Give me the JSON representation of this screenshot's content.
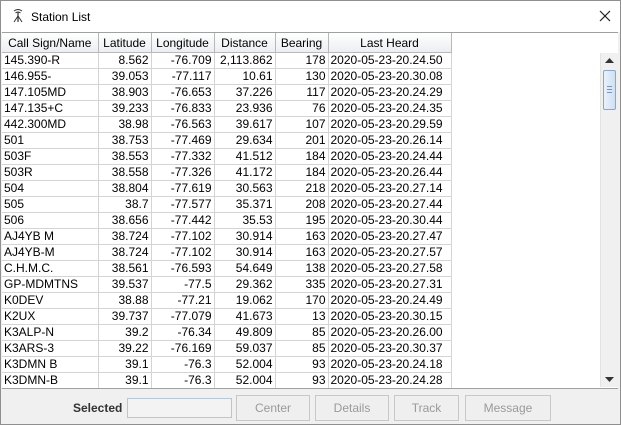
{
  "window": {
    "title": "Station List"
  },
  "icons": {
    "app": "antenna-icon",
    "close": "close-icon"
  },
  "table": {
    "columns": [
      "Call Sign/Name",
      "Latitude",
      "Longitude",
      "Distance",
      "Bearing",
      "Last Heard"
    ],
    "rows": [
      [
        "145.390-R",
        "8.562",
        "-76.709",
        "2,113.862",
        "178",
        "2020-05-23-20.24.50"
      ],
      [
        "146.955-",
        "39.053",
        "-77.117",
        "10.61",
        "130",
        "2020-05-23-20.30.08"
      ],
      [
        "147.105MD",
        "38.903",
        "-76.653",
        "37.226",
        "117",
        "2020-05-23-20.24.29"
      ],
      [
        "147.135+C",
        "39.233",
        "-76.833",
        "23.936",
        "76",
        "2020-05-23-20.24.35"
      ],
      [
        "442.300MD",
        "38.98",
        "-76.563",
        "39.617",
        "107",
        "2020-05-23-20.29.59"
      ],
      [
        "501",
        "38.753",
        "-77.469",
        "29.634",
        "201",
        "2020-05-23-20.26.14"
      ],
      [
        "503F",
        "38.553",
        "-77.332",
        "41.512",
        "184",
        "2020-05-23-20.24.44"
      ],
      [
        "503R",
        "38.558",
        "-77.326",
        "41.172",
        "184",
        "2020-05-23-20.26.44"
      ],
      [
        "504",
        "38.804",
        "-77.619",
        "30.563",
        "218",
        "2020-05-23-20.27.14"
      ],
      [
        "505",
        "38.7",
        "-77.577",
        "35.371",
        "208",
        "2020-05-23-20.27.44"
      ],
      [
        "506",
        "38.656",
        "-77.442",
        "35.53",
        "195",
        "2020-05-23-20.30.44"
      ],
      [
        "AJ4YB  M",
        "38.724",
        "-77.102",
        "30.914",
        "163",
        "2020-05-23-20.27.47"
      ],
      [
        "AJ4YB-M",
        "38.724",
        "-77.102",
        "30.914",
        "163",
        "2020-05-23-20.27.57"
      ],
      [
        "C.H.M.C.",
        "38.561",
        "-76.593",
        "54.649",
        "138",
        "2020-05-23-20.27.58"
      ],
      [
        "GP-MDMTNS",
        "39.537",
        "-77.5",
        "29.362",
        "335",
        "2020-05-23-20.27.31"
      ],
      [
        "K0DEV",
        "38.88",
        "-77.21",
        "19.062",
        "170",
        "2020-05-23-20.24.49"
      ],
      [
        "K2UX",
        "39.737",
        "-77.079",
        "41.673",
        "13",
        "2020-05-23-20.30.15"
      ],
      [
        "K3ALP-N",
        "39.2",
        "-76.34",
        "49.809",
        "85",
        "2020-05-23-20.26.00"
      ],
      [
        "K3ARS-3",
        "39.22",
        "-76.169",
        "59.037",
        "85",
        "2020-05-23-20.30.37"
      ],
      [
        "K3DMN  B",
        "39.1",
        "-76.3",
        "52.004",
        "93",
        "2020-05-23-20.24.18"
      ],
      [
        "K3DMN-B",
        "39.1",
        "-76.3",
        "52.004",
        "93",
        "2020-05-23-20.24.28"
      ]
    ]
  },
  "footer": {
    "selected_label": "Selected",
    "selected_value": "",
    "buttons": {
      "center": "Center",
      "details": "Details",
      "track": "Track",
      "message": "Message"
    }
  }
}
